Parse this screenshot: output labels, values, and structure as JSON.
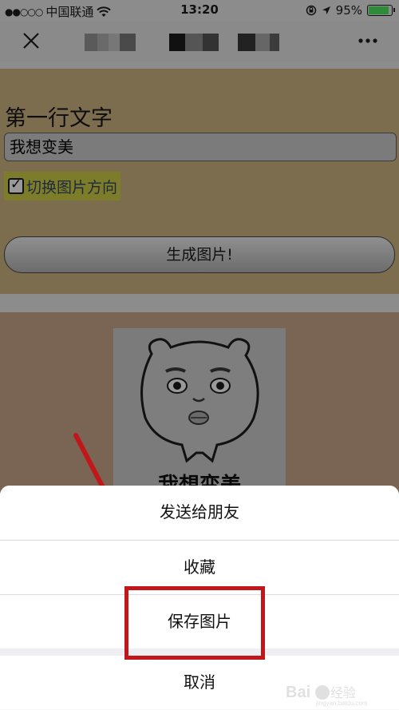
{
  "status_bar": {
    "signal": "●●○○○",
    "carrier": "中国联通",
    "time": "13:20",
    "battery": "95%",
    "battery_level": 0.95
  },
  "nav": {
    "close_icon": "close-icon",
    "more_icon": "more-icon"
  },
  "form": {
    "field_label": "第一行文字",
    "field_value": "我想变美",
    "toggle_label": "切换图片方向",
    "toggle_checked": true,
    "generate_label": "生成图片!"
  },
  "result": {
    "caption": "我想变美"
  },
  "action_sheet": {
    "items": [
      "发送给朋友",
      "收藏",
      "保存图片"
    ],
    "cancel_label": "取消"
  },
  "watermark": {
    "text": "Bai du 经验",
    "url": "jingyan.baidu.com"
  },
  "colors": {
    "highlight": "#c1171a",
    "sheet_background": "#ffffff"
  }
}
